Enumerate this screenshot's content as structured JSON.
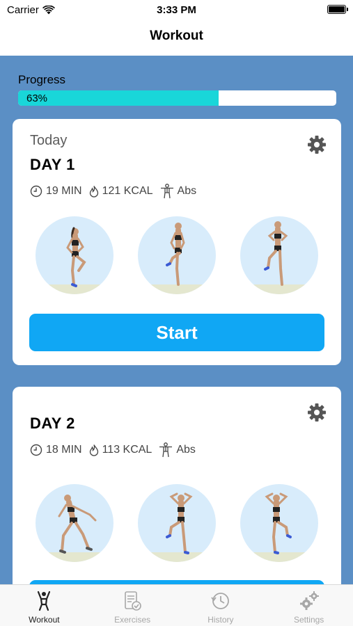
{
  "status_bar": {
    "carrier": "Carrier",
    "time": "3:33 PM"
  },
  "nav": {
    "title": "Workout"
  },
  "progress": {
    "label": "Progress",
    "value_text": "63%",
    "fraction": 0.63,
    "fill_color": "#19d6d9"
  },
  "days": [
    {
      "subtitle": "Today",
      "title": "DAY 1",
      "duration": "19 MIN",
      "calories": "121 KCAL",
      "focus": "Abs",
      "exercises": [
        "knee-raise-pose",
        "high-knee-pose",
        "knee-tuck-pose"
      ],
      "button_label": "Start"
    },
    {
      "title": "DAY 2",
      "duration": "18 MIN",
      "calories": "113 KCAL",
      "focus": "Abs",
      "exercises": [
        "side-lunge-pose",
        "standing-crunch-pose",
        "elbow-to-knee-pose"
      ]
    }
  ],
  "tabs": [
    {
      "label": "Workout",
      "icon": "person-icon",
      "active": true
    },
    {
      "label": "Exercises",
      "icon": "checklist-icon",
      "active": false
    },
    {
      "label": "History",
      "icon": "clock-history-icon",
      "active": false
    },
    {
      "label": "Settings",
      "icon": "gears-icon",
      "active": false
    }
  ],
  "colors": {
    "background": "#5b8fc5",
    "accent": "#10a7f4",
    "progress": "#19d6d9"
  }
}
